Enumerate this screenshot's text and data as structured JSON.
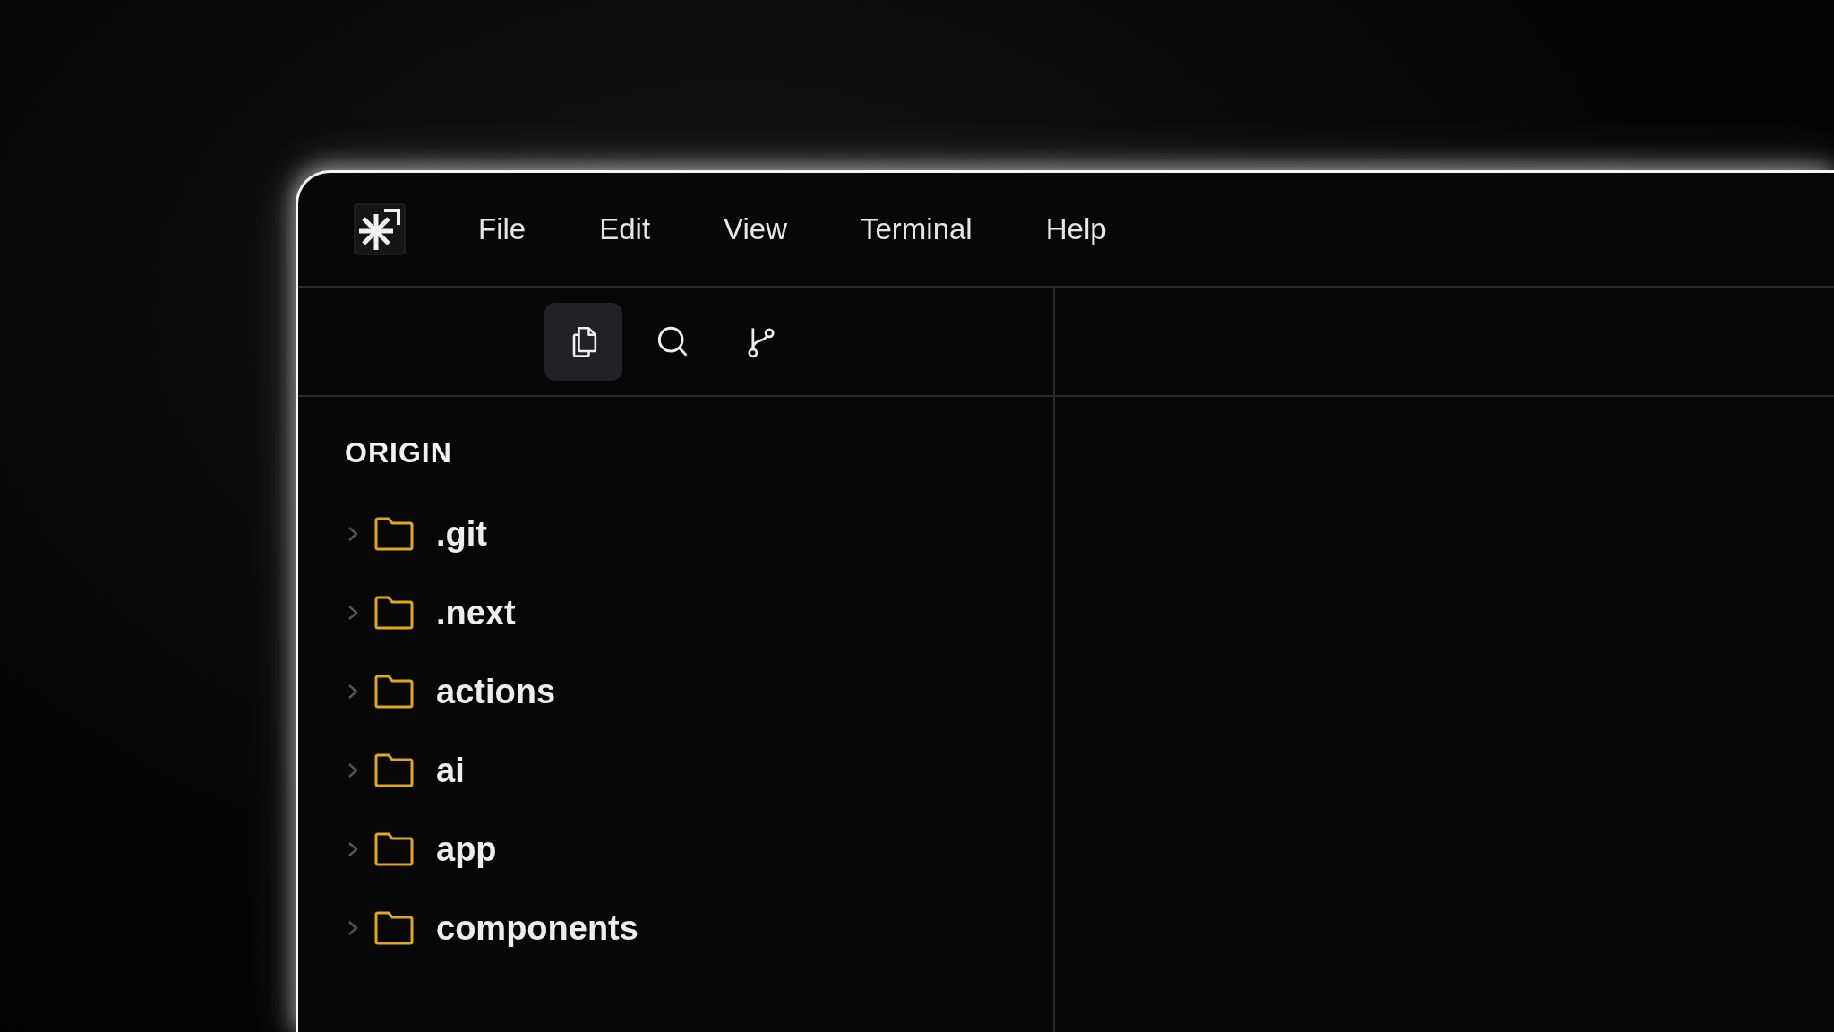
{
  "menu": [
    {
      "label": "File"
    },
    {
      "label": "Edit"
    },
    {
      "label": "View"
    },
    {
      "label": "Terminal"
    },
    {
      "label": "Help"
    }
  ],
  "toolbar": [
    {
      "kind": "files",
      "selected": true
    },
    {
      "kind": "search",
      "selected": false
    },
    {
      "kind": "branch",
      "selected": false
    }
  ],
  "explorer": {
    "title": "ORIGIN",
    "items": [
      {
        "name": ".git",
        "expanded": false
      },
      {
        "name": ".next",
        "expanded": false
      },
      {
        "name": "actions",
        "expanded": false
      },
      {
        "name": "ai",
        "expanded": false
      },
      {
        "name": "app",
        "expanded": false
      },
      {
        "name": "components",
        "expanded": false
      }
    ]
  }
}
